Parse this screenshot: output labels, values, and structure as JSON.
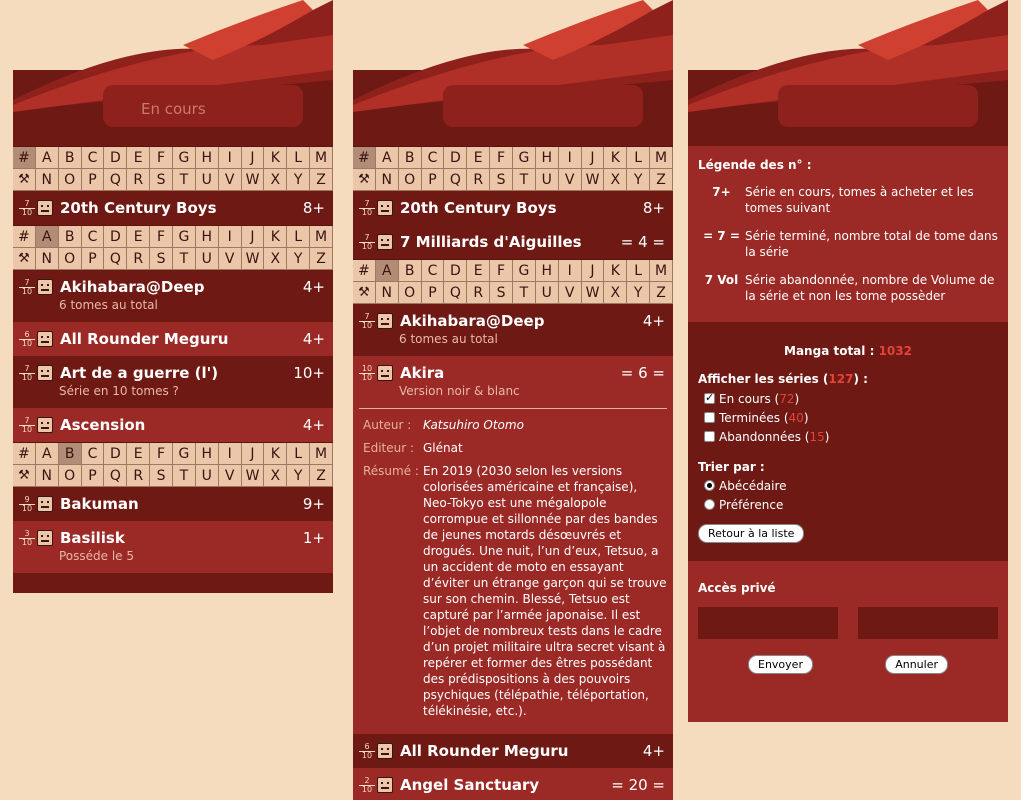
{
  "alphabet_row1": [
    "#",
    "A",
    "B",
    "C",
    "D",
    "E",
    "F",
    "G",
    "H",
    "I",
    "J",
    "K",
    "L",
    "M"
  ],
  "alphabet_row2": [
    "⚒",
    "N",
    "O",
    "P",
    "Q",
    "R",
    "S",
    "T",
    "U",
    "V",
    "W",
    "X",
    "Y",
    "Z"
  ],
  "panel1": {
    "header_title": "En cours",
    "entries": [
      {
        "rating_num": "7",
        "rating_den": "10",
        "title": "20th Century Boys",
        "count": "8+"
      },
      {
        "rating_num": "7",
        "rating_den": "10",
        "title": "Akihabara@Deep",
        "count": "4+",
        "note": "6 tomes au total"
      },
      {
        "rating_num": "6",
        "rating_den": "10",
        "title": "All Rounder Meguru",
        "count": "4+"
      },
      {
        "rating_num": "7",
        "rating_den": "10",
        "title": "Art de a guerre (l')",
        "count": "10+",
        "note": "Série en 10 tomes ?"
      },
      {
        "rating_num": "7",
        "rating_den": "10",
        "title": "Ascension",
        "count": "4+"
      },
      {
        "rating_num": "9",
        "rating_den": "10",
        "title": "Bakuman",
        "count": "9+"
      },
      {
        "rating_num": "3",
        "rating_den": "10",
        "title": "Basilisk",
        "count": "1+",
        "note": "Posséde le 5"
      }
    ]
  },
  "panel2": {
    "entries": [
      {
        "rating_num": "7",
        "rating_den": "10",
        "title": "20th Century Boys",
        "count": "8+"
      },
      {
        "rating_num": "7",
        "rating_den": "10",
        "title": "7 Milliards d'Aiguilles",
        "count": "= 4 ="
      },
      {
        "rating_num": "7",
        "rating_den": "10",
        "title": "Akihabara@Deep",
        "count": "4+",
        "note": "6 tomes au total"
      },
      {
        "rating_num": "10",
        "rating_den": "10",
        "title": "Akira",
        "count": "= 6 =",
        "note": "Version noir & blanc"
      },
      {
        "rating_num": "6",
        "rating_den": "10",
        "title": "All Rounder Meguru",
        "count": "4+"
      },
      {
        "rating_num": "2",
        "rating_den": "10",
        "title": "Angel Sanctuary",
        "count": "= 20 ="
      }
    ],
    "details": {
      "author_label": "Auteur :",
      "author": "Katsuhiro Otomo",
      "editor_label": "Editeur :",
      "editor": "Glénat",
      "summary_label": "Résumé :",
      "summary": "En 2019 (2030 selon les versions colorisées américaine et française), Neo-Tokyo est une mégalopole corrompue et sillonnée par des bandes de jeunes motards désœuvrés et drogués. Une nuit, l’un d’eux, Tetsuo, a un accident de moto en essayant d’éviter un étrange garçon qui se trouve sur son chemin. Blessé, Tetsuo est capturé par l’armée japonaise. Il est l’objet de nombreux tests dans le cadre d’un projet militaire ultra secret visant à repérer et former des êtres possédant des prédispositions à des pouvoirs psychiques (télépathie, téléportation, télékinésie, etc.)."
    }
  },
  "panel3": {
    "legend_title": "Légende des n° :",
    "legend": [
      {
        "key": "7+",
        "text": "Série en cours, tomes à acheter et les tomes suivant"
      },
      {
        "key": "= 7 =",
        "text": "Série terminé, nombre total de tome dans la série"
      },
      {
        "key": "7 Vol",
        "text": "Série abandonnée, nombre de Volume de la série et non les tome possèder"
      }
    ],
    "total_label": "Manga total :",
    "total_value": "1032",
    "show_label": "Afficher les séries (",
    "show_count": "127",
    "show_suffix": ") :",
    "filters": [
      {
        "label": "En cours (",
        "count": "72",
        "suffix": ")",
        "checked": true
      },
      {
        "label": "Terminées (",
        "count": "40",
        "suffix": ")",
        "checked": false
      },
      {
        "label": "Abandonnées (",
        "count": "15",
        "suffix": ")",
        "checked": false
      }
    ],
    "sort_label": "Trier par :",
    "sort_options": [
      {
        "label": "Abécédaire",
        "checked": true
      },
      {
        "label": "Préférence",
        "checked": false
      }
    ],
    "back_button": "Retour à la liste",
    "private_label": "Accès privé",
    "send_button": "Envoyer",
    "cancel_button": "Annuler"
  },
  "colors": {
    "background": "#f6dcbf",
    "dark_red": "#6e1913",
    "mid_red": "#9b2a26",
    "accent_red": "#e2433a",
    "tile": "#ebc6a8"
  }
}
